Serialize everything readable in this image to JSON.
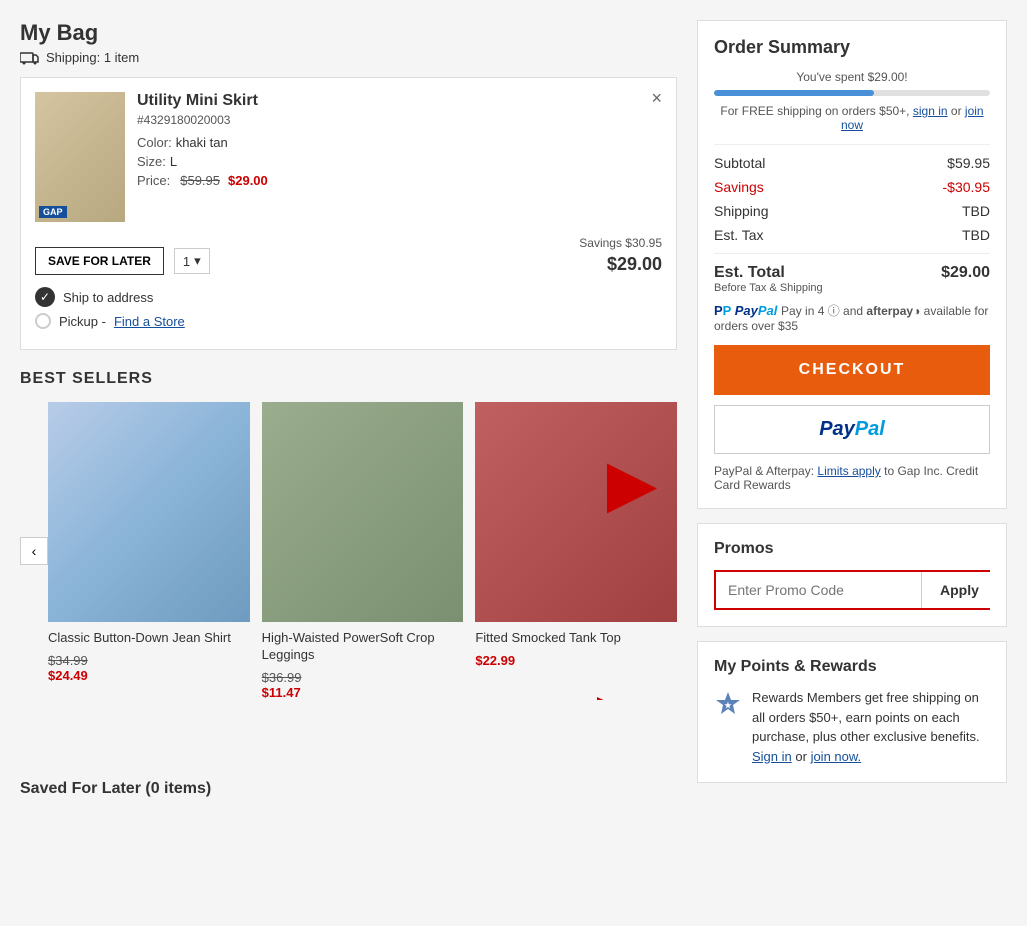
{
  "page": {
    "my_bag_title": "My Bag",
    "shipping_info": "Shipping: 1 item"
  },
  "cart_item": {
    "name": "Utility Mini Skirt",
    "sku": "#4329180020003",
    "color_label": "Color:",
    "color_value": "khaki tan",
    "size_label": "Size:",
    "size_value": "L",
    "price_label": "Price:",
    "original_price": "$59.95",
    "sale_price": "$29.00",
    "save_for_later": "SAVE FOR LATER",
    "quantity": "1",
    "savings_text": "Savings $30.95",
    "item_total": "$29.00",
    "close_label": "×",
    "ship_to_address": "Ship to address",
    "pickup_label": "Pickup -",
    "find_store": "Find a Store"
  },
  "best_sellers": {
    "title": "BEST SELLERS",
    "prev_arrow": "‹",
    "products": [
      {
        "name": "Classic Button-Down Jean Shirt",
        "original_price": "$34.99",
        "sale_price": "$24.49",
        "img_class": "img-jeanshirt"
      },
      {
        "name": "High-Waisted PowerSoft Crop Leggings",
        "original_price": "$36.99",
        "sale_price": "$11.47",
        "img_class": "img-leggings"
      },
      {
        "name": "Fitted Smocked Tank Top",
        "original_price": null,
        "sale_price": "$22.99",
        "img_class": "img-tanktop"
      }
    ]
  },
  "saved_for_later": {
    "label": "Saved For Later (0 items)"
  },
  "order_summary": {
    "title": "Order Summary",
    "progress_text": "You've spent $29.00!",
    "progress_percent": 58,
    "free_shipping_text": "For FREE shipping on orders $50+,",
    "sign_in": "sign in",
    "or": "or",
    "join_now": "join now",
    "subtotal_label": "Subtotal",
    "subtotal_value": "$59.95",
    "savings_label": "Savings",
    "savings_value": "-$30.95",
    "shipping_label": "Shipping",
    "shipping_value": "TBD",
    "est_tax_label": "Est. Tax",
    "est_tax_value": "TBD",
    "est_total_label": "Est. Total",
    "est_total_sub": "Before Tax & Shipping",
    "est_total_value": "$29.00",
    "paypal_info": "Pay in 4",
    "paypal_text": "and afterpay",
    "paypal_subtext": "available for orders over $35",
    "checkout_label": "CHECKOUT",
    "paypal_limits_prefix": "PayPal & Afterpay:",
    "paypal_limits_link": "Limits apply",
    "paypal_limits_suffix": "to Gap Inc. Credit Card Rewards"
  },
  "promos": {
    "title": "Promos",
    "input_placeholder": "Enter Promo Code",
    "apply_label": "Apply"
  },
  "rewards": {
    "title": "My Points & Rewards",
    "text": "Rewards Members get free shipping on all orders $50+, earn points on each purchase, plus other exclusive benefits.",
    "sign_in": "Sign in",
    "or": "or",
    "join_now": "join now."
  }
}
